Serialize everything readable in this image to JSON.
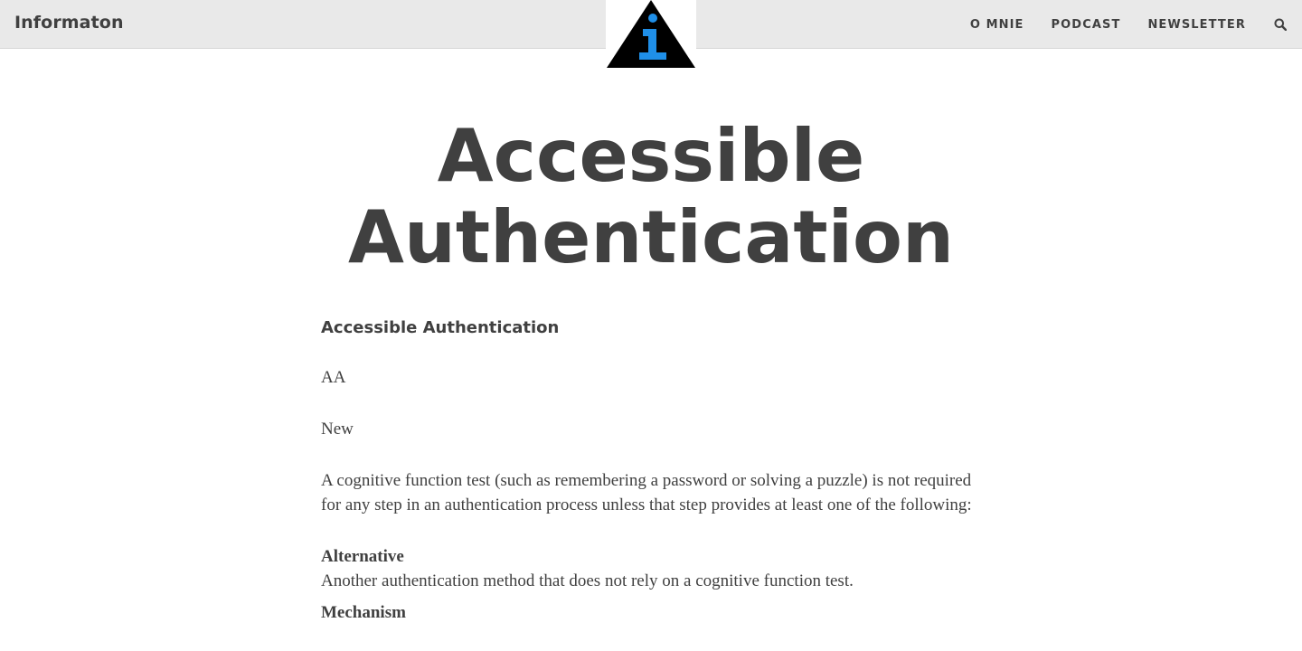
{
  "header": {
    "site_title": "Informaton",
    "nav": [
      {
        "label": "O MNIE"
      },
      {
        "label": "PODCAST"
      },
      {
        "label": "NEWSLETTER"
      }
    ],
    "search_icon": "search-icon",
    "logo_icon": "info-triangle-icon",
    "logo_colors": {
      "triangle": "#000000",
      "glyph": "#1f8fe8"
    }
  },
  "hero": {
    "title_line1": "Accessible",
    "title_line2": "Authentication"
  },
  "article": {
    "heading": "Accessible Authentication",
    "level": "AA",
    "status": "New",
    "description": "A cognitive function test (such as remembering a password or solving a puzzle) is not required for any step in an authentication process unless that step provides at least one of the following:",
    "items": [
      {
        "term": "Alternative",
        "description": "Another authentication method that does not rely on a cognitive function test."
      },
      {
        "term": "Mechanism",
        "description": ""
      }
    ]
  }
}
